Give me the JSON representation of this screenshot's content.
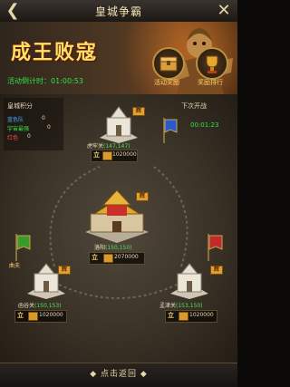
{
  "header": {
    "title": "皇城争霸",
    "back_icon": "back-arrow-icon",
    "close_icon": "close-icon"
  },
  "banner": {
    "event_title": "成王败寇",
    "countdown": "活动倒计时：01:00:53",
    "buttons": [
      {
        "label": "活动奖励",
        "icon": "reward-chest-icon"
      },
      {
        "label": "奖励排行",
        "icon": "ranking-trophy-icon"
      }
    ]
  },
  "score_panel": {
    "title": "皇城积分",
    "factions": [
      {
        "name": "蓝色队",
        "score": "0",
        "color": "#4aa8ff"
      },
      {
        "name": "宇宙最强",
        "score": "0",
        "color": "#3fe04a"
      },
      {
        "name": "红色",
        "score": "0",
        "color": "#ff4444"
      }
    ]
  },
  "next_war": {
    "label": "下次开战",
    "time": "00:01:23"
  },
  "cities": [
    {
      "name": "虎牢关",
      "coords": "(147,147)",
      "tag": "辉",
      "li": "立",
      "reward": "1020000"
    },
    {
      "name": "洛阳",
      "coords": "(150,150)",
      "tag": "辉",
      "li": "立",
      "reward": "2070000"
    },
    {
      "name": "函谷关",
      "coords": "(150,153)",
      "tag": "辉",
      "li": "立",
      "reward": "1020000"
    },
    {
      "name": "孟津关",
      "coords": "(153,150)",
      "tag": "辉",
      "li": "立",
      "reward": "1020000"
    }
  ],
  "player_flag": {
    "label": "曲夫"
  },
  "footer": {
    "return_label": "点击返回"
  },
  "colors": {
    "accent": "#ffd36a",
    "timer_green": "#2fe04a",
    "frame_gold": "#b8923e"
  }
}
